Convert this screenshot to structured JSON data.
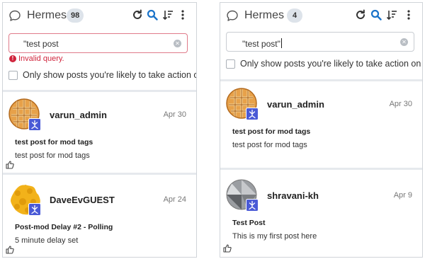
{
  "colors": {
    "accent": "#1a73c9",
    "error": "#d0243c",
    "badge_bg": "#dde3ea",
    "divider": "#e6e9ed",
    "mod_badge": "#4a5ad6"
  },
  "panels": [
    {
      "app_title": "Hermes",
      "count": "98",
      "search_value": "\"test post",
      "error_text": "Invalid query.",
      "filter_label": "Only show posts you're likely to take action on",
      "posts": [
        {
          "author": "varun_admin",
          "date": "Apr 30",
          "title": "test post for mod tags",
          "body": "test post for mod tags",
          "avatar_icon": "waffle-avatar-icon"
        },
        {
          "author": "DaveEvGUEST",
          "date": "Apr 24",
          "title": "Post-mod Delay #2 - Polling",
          "body": "5 minute delay set",
          "avatar_icon": "cookie-avatar-icon"
        }
      ]
    },
    {
      "app_title": "Hermes",
      "count": "4",
      "search_value": "\"test post\"",
      "filter_label": "Only show posts you're likely to take action on",
      "posts": [
        {
          "author": "varun_admin",
          "date": "Apr 30",
          "title": "test post for mod tags",
          "body": "test post for mod tags",
          "avatar_icon": "waffle-avatar-icon"
        },
        {
          "author": "shravani-kh",
          "date": "Apr 9",
          "title": "Test Post",
          "body": "This is my first post here",
          "avatar_icon": "gray-geometric-avatar-icon"
        }
      ]
    }
  ]
}
